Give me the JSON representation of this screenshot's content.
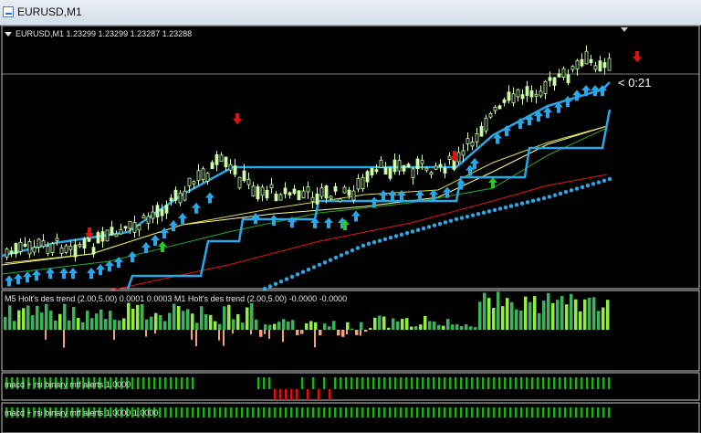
{
  "window": {
    "title": "EURUSD,M1"
  },
  "main_pane": {
    "header": "EURUSD,M1  1.23299 1.23299 1.23287 1.23288",
    "countdown": "< 0:21"
  },
  "indicator_1": {
    "label": "M5 Holt's des trend (2.00,5.00) 0.0001 0.0003   M1 Holt's des trend (2.00,5.00) -0.0000 -0.0000"
  },
  "indicator_2": {
    "label": "macd + rsi binary mtf alerts 1.0000"
  },
  "indicator_3": {
    "label": "macd + rsi binary mtf alerts 1.0000 1.0000"
  },
  "colors": {
    "bull_candle": "#ccffaa",
    "bear_candle": "#000000",
    "band_blue": "#29a8e8",
    "arrow_up": "#29a8e8",
    "arrow_green": "#22cc22",
    "arrow_red": "#e01010",
    "hist_green": "#3cb35a",
    "hist_lime": "#90ee40",
    "hist_orange": "#f5a07a"
  },
  "icons": {
    "window": "chart-window-icon",
    "collapse": "triangle-down-icon"
  }
}
